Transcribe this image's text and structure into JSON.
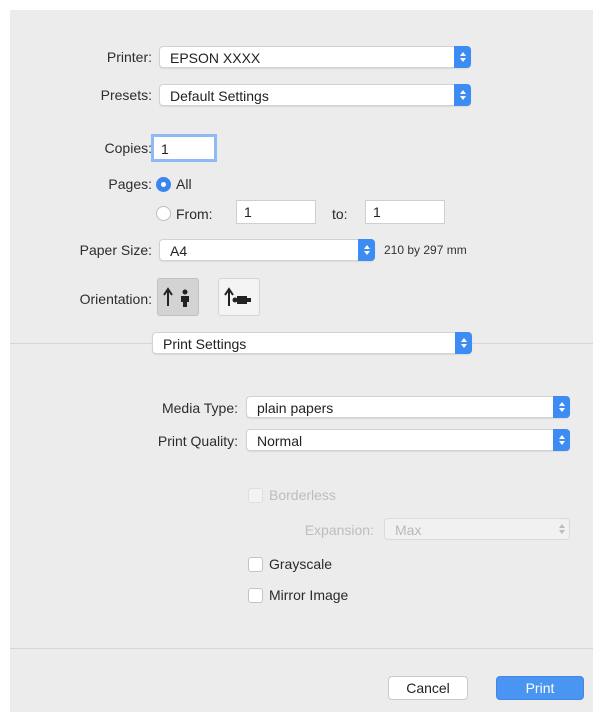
{
  "printer": {
    "label": "Printer:",
    "value": "EPSON XXXX"
  },
  "presets": {
    "label": "Presets:",
    "value": "Default Settings"
  },
  "copies": {
    "label": "Copies:",
    "value": "1"
  },
  "pages": {
    "label": "Pages:",
    "all_label": "All",
    "from_label": "From:",
    "from_value": "1",
    "to_label": "to:",
    "to_value": "1",
    "selected": "All"
  },
  "paper_size": {
    "label": "Paper Size:",
    "value": "A4",
    "dimensions": "210 by 297 mm"
  },
  "orientation": {
    "label": "Orientation:",
    "selected": "portrait"
  },
  "section_popup": {
    "value": "Print Settings"
  },
  "media_type": {
    "label": "Media Type:",
    "value": "plain papers"
  },
  "print_quality": {
    "label": "Print Quality:",
    "value": "Normal"
  },
  "borderless": {
    "label": "Borderless",
    "checked": false,
    "enabled": false
  },
  "expansion": {
    "label": "Expansion:",
    "value": "Max",
    "enabled": false
  },
  "grayscale": {
    "label": "Grayscale",
    "checked": false
  },
  "mirror_image": {
    "label": "Mirror Image",
    "checked": false
  },
  "buttons": {
    "cancel": "Cancel",
    "print": "Print"
  },
  "colors": {
    "accent": "#3d8cf3",
    "background": "#ececec"
  }
}
